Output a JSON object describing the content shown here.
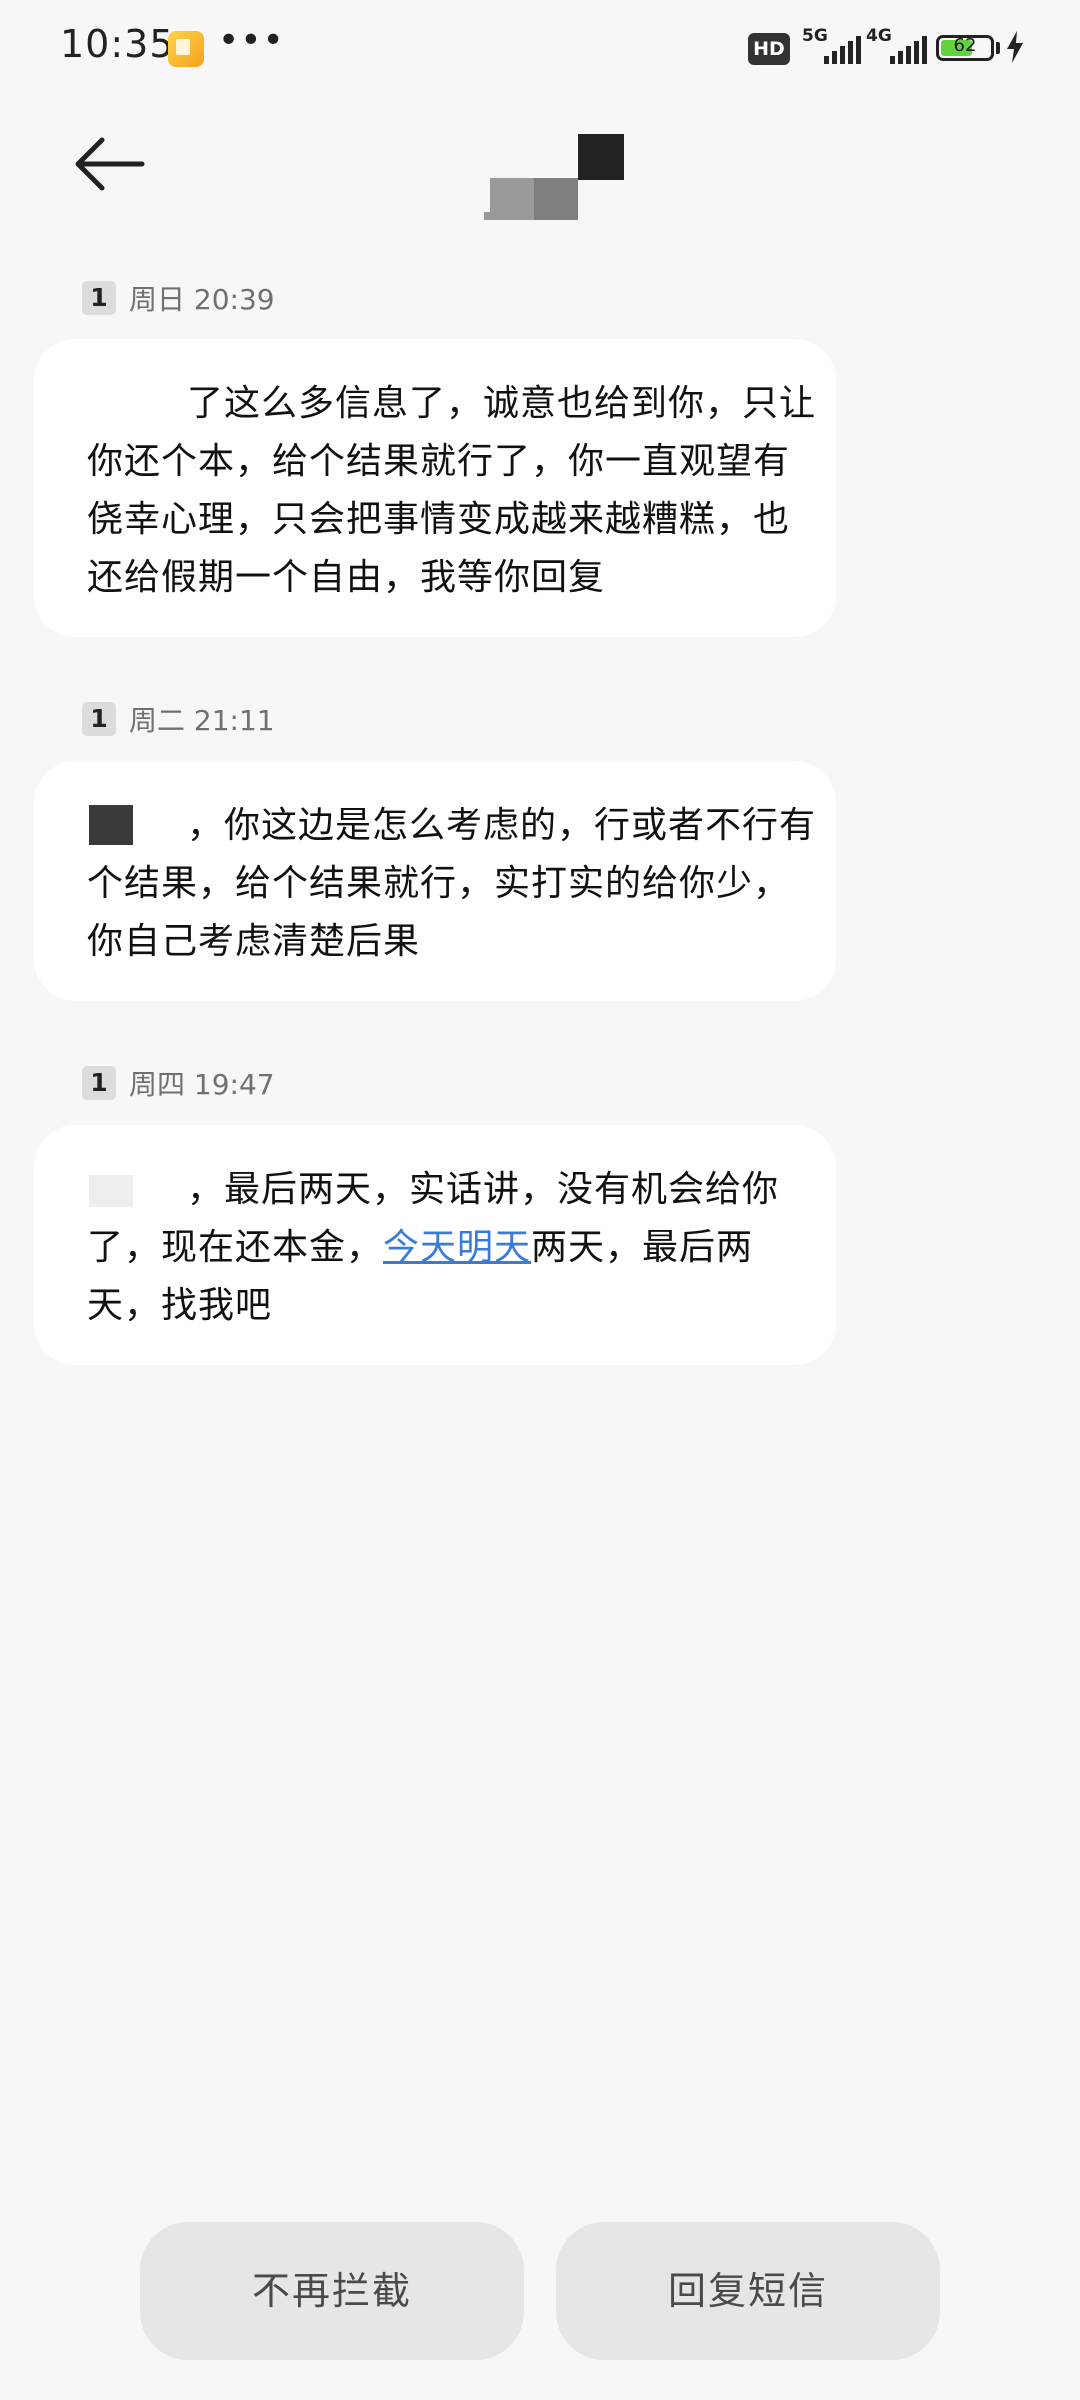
{
  "status_bar": {
    "time": "10:35",
    "more": "•••",
    "hd": "HD",
    "network_1": "5G",
    "network_2": "4G",
    "battery_level": "62"
  },
  "icons": {
    "back": "arrow-left-icon",
    "notification": "notes-app-icon",
    "charging": "lightning-bolt-icon"
  },
  "messages": [
    {
      "sim": "1",
      "time": "周日 20:39",
      "text": "了这么多信息了，诚意也给到你，只让你还个本，给个结果就行了，你一直观望有侥幸心理，只会把事情变成越来越糟糕，也还给假期一个自由，我等你回复"
    },
    {
      "sim": "1",
      "time": "周二 21:11",
      "text": "，你这边是怎么考虑的，行或者不行有个结果，给个结果就行，实打实的给你少，你自己考虑清楚后果"
    },
    {
      "sim": "1",
      "time": "周四 19:47",
      "text_before": "，最后两天，实话讲，没有机会给你了，现在还本金，",
      "link": "今天明天",
      "text_after": "两天，最后两天，找我吧"
    }
  ],
  "actions": {
    "unblock": "不再拦截",
    "reply": "回复短信"
  }
}
